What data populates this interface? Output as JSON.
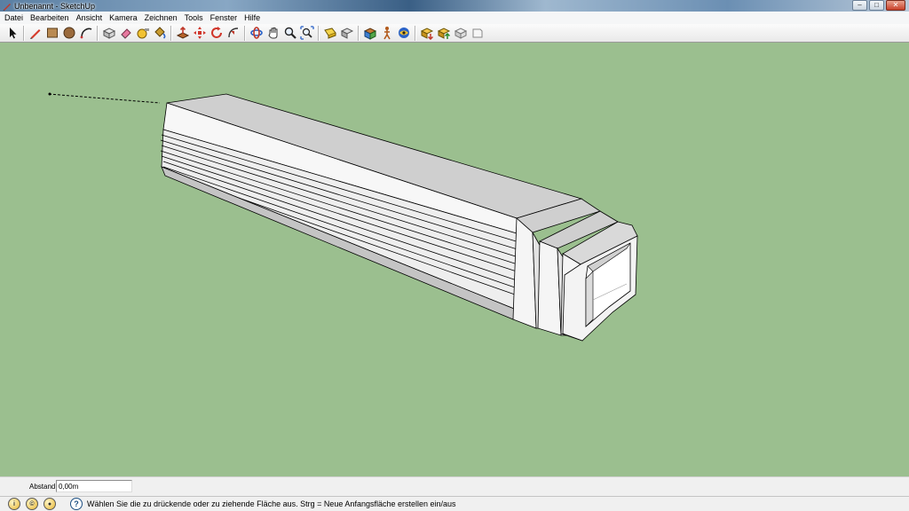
{
  "window": {
    "title": "Unbenannt - SketchUp",
    "minimize_glyph": "–",
    "maximize_glyph": "□",
    "close_glyph": "✕"
  },
  "menu": {
    "items": [
      "Datei",
      "Bearbeiten",
      "Ansicht",
      "Kamera",
      "Zeichnen",
      "Tools",
      "Fenster",
      "Hilfe"
    ]
  },
  "toolbar": {
    "icons": [
      "select-arrow-icon",
      "pencil-line-icon",
      "rectangle-icon",
      "circle-icon",
      "arc-icon",
      "make-component-icon",
      "eraser-icon",
      "tape-measure-icon",
      "paint-bucket-icon",
      "push-pull-icon",
      "move-icon",
      "rotate-icon",
      "follow-me-icon",
      "orbit-icon",
      "pan-hand-icon",
      "zoom-icon",
      "zoom-extents-icon",
      "previous-view-icon",
      "next-view-icon",
      "standard-views-icon",
      "walk-icon",
      "position-camera-icon",
      "get-models-icon",
      "share-model-icon",
      "component-share-icon",
      "extension-icon"
    ]
  },
  "colors": {
    "viewport_background": "#9bbf8f",
    "model_face_light": "#f4f4f4",
    "model_face_mid": "#dcdcdc",
    "model_face_dark": "#c3c3c3",
    "edge": "#000000"
  },
  "measurements": {
    "label": "Abstand",
    "value": "0,00m"
  },
  "status": {
    "icons": [
      "geo-location-icon",
      "credits-icon",
      "user-icon"
    ],
    "help_glyph": "?",
    "message": "Wählen Sie die zu drückende oder zu ziehende Fläche aus.  Strg = Neue Anfangsfläche erstellen ein/aus"
  }
}
